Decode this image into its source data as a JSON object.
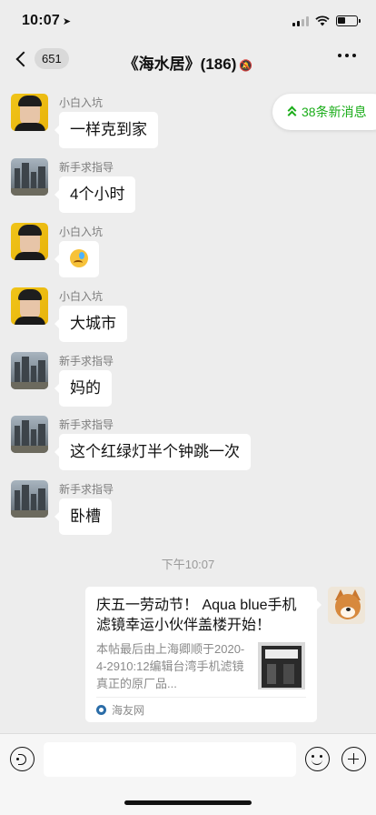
{
  "status": {
    "time": "10:07",
    "location_icon": "location-arrow-icon"
  },
  "header": {
    "back_count": "651",
    "title": "《海水居》(186)",
    "mute_icon": "bell-off-icon"
  },
  "new_messages": {
    "label": "38条新消息"
  },
  "messages": [
    {
      "sender": "小白入坑",
      "text": "一样克到家",
      "avatar": "portrait-avatar"
    },
    {
      "sender": "新手求指导",
      "text": "4个小时",
      "avatar": "city-avatar"
    },
    {
      "sender": "小白入坑",
      "text": "",
      "emoji": "crying-laughing-emoji",
      "avatar": "portrait-avatar"
    },
    {
      "sender": "小白入坑",
      "text": "大城市",
      "avatar": "portrait-avatar"
    },
    {
      "sender": "新手求指导",
      "text": "妈的",
      "avatar": "city-avatar"
    },
    {
      "sender": "新手求指导",
      "text": "这个红绿灯半个钟跳一次",
      "avatar": "city-avatar"
    },
    {
      "sender": "新手求指导",
      "text": "卧槽",
      "avatar": "city-avatar"
    }
  ],
  "time_divider": "下午10:07",
  "link_card": {
    "title": "庆五一劳动节！ Aqua blue手机滤镜幸运小伙伴盖楼开始！",
    "desc": "本帖最后由上海卿顺于2020-4-2910:12编辑台湾手机滤镜真正的原厂品...",
    "source": "海友网"
  },
  "input": {
    "placeholder": ""
  }
}
